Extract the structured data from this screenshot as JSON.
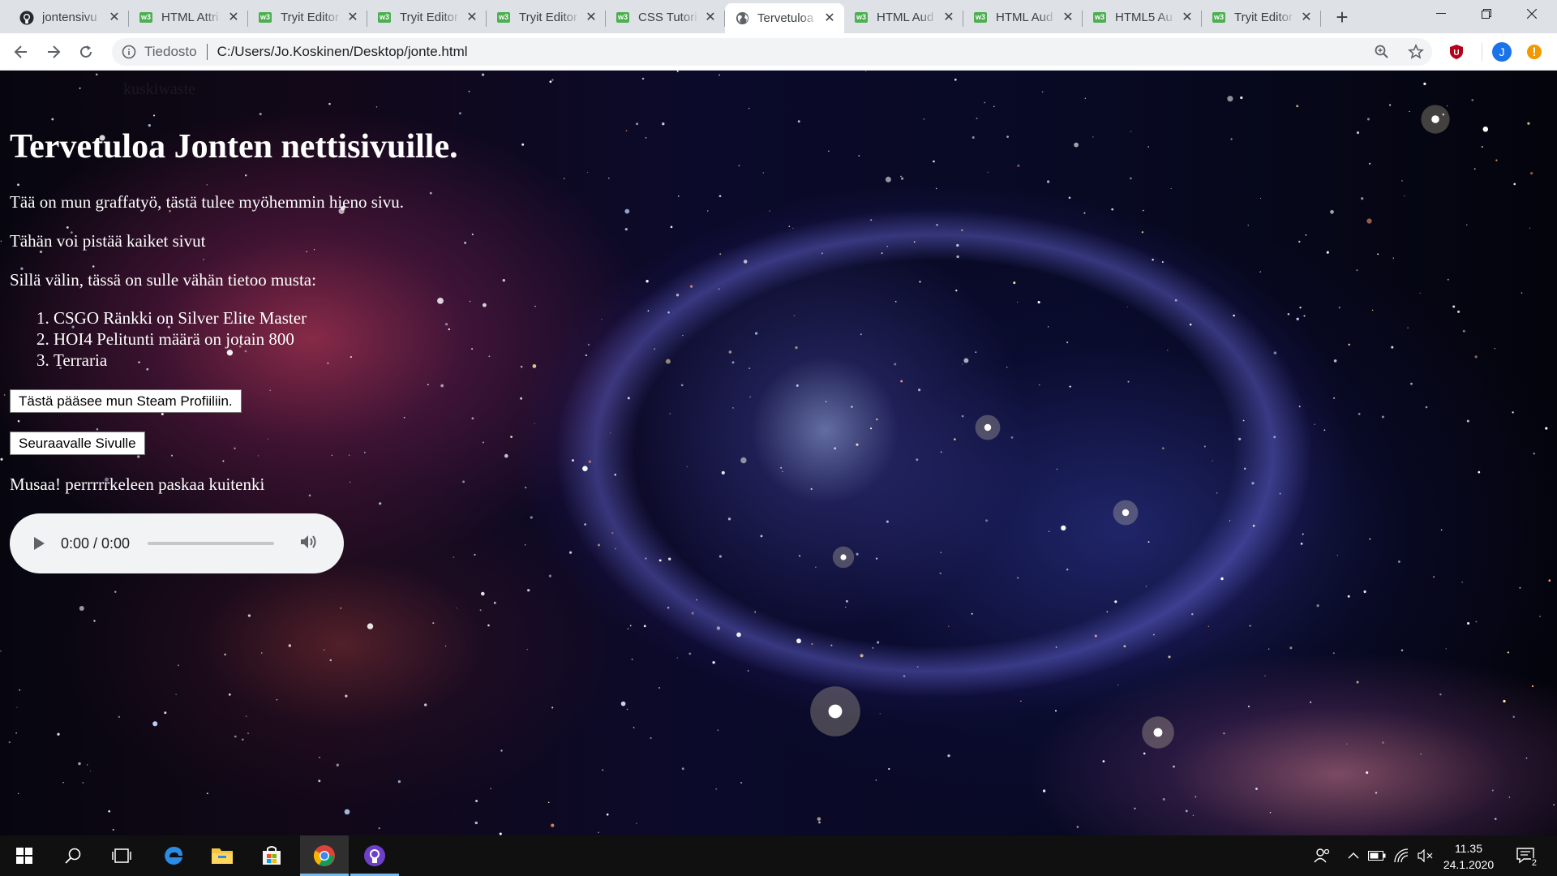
{
  "tabs": [
    {
      "title": "jontensivu",
      "favicon": "github-icon"
    },
    {
      "title": "HTML Attri",
      "favicon": "w3schools-icon"
    },
    {
      "title": "Tryit Editor",
      "favicon": "w3schools-icon"
    },
    {
      "title": "Tryit Editor",
      "favicon": "w3schools-icon"
    },
    {
      "title": "Tryit Editor",
      "favicon": "w3schools-icon"
    },
    {
      "title": "CSS Tutori",
      "favicon": "w3schools-icon"
    },
    {
      "title": "Tervetuloa",
      "favicon": "globe-icon",
      "active": true
    },
    {
      "title": "HTML Aud",
      "favicon": "w3schools-icon"
    },
    {
      "title": "HTML Aud",
      "favicon": "w3schools-icon"
    },
    {
      "title": "HTML5 Au",
      "favicon": "w3schools-icon"
    },
    {
      "title": "Tryit Editor",
      "favicon": "w3schools-icon"
    }
  ],
  "address": {
    "scheme_label": "Tiedosto",
    "url": "C:/Users/Jo.Koskinen/Desktop/jonte.html"
  },
  "profile": {
    "initial": "J",
    "color": "#1a73e8"
  },
  "page": {
    "hidden_link_text": "kuskiwaste",
    "heading": "Tervetuloa Jonten nettisivuille.",
    "paragraphs": [
      "Tää on mun graffatyö, tästä tulee myöhemmin hieno sivu.",
      "Tähän voi pistää kaiket sivut",
      "Sillä välin, tässä on sulle vähän tietoo musta:"
    ],
    "list_items": [
      "CSGO Ränkki on Silver Elite Master",
      "HOI4 Pelitunti määrä on jotain 800",
      "Terraria"
    ],
    "steam_button": "Tästä pääsee mun Steam Profiiliin.",
    "next_button": "Seuraavalle Sivulle",
    "music_text": "Musaa! perrrrrkeleen paskaa kuitenki",
    "audio_time": "0:00 / 0:00"
  },
  "taskbar": {
    "time": "11.35",
    "date": "24.1.2020",
    "notification_count": "2"
  },
  "colors": {
    "tabstrip": "#dee1e6",
    "taskbar": "#101010",
    "w3schools_green": "#4caf50",
    "page_text": "#ffffff"
  }
}
